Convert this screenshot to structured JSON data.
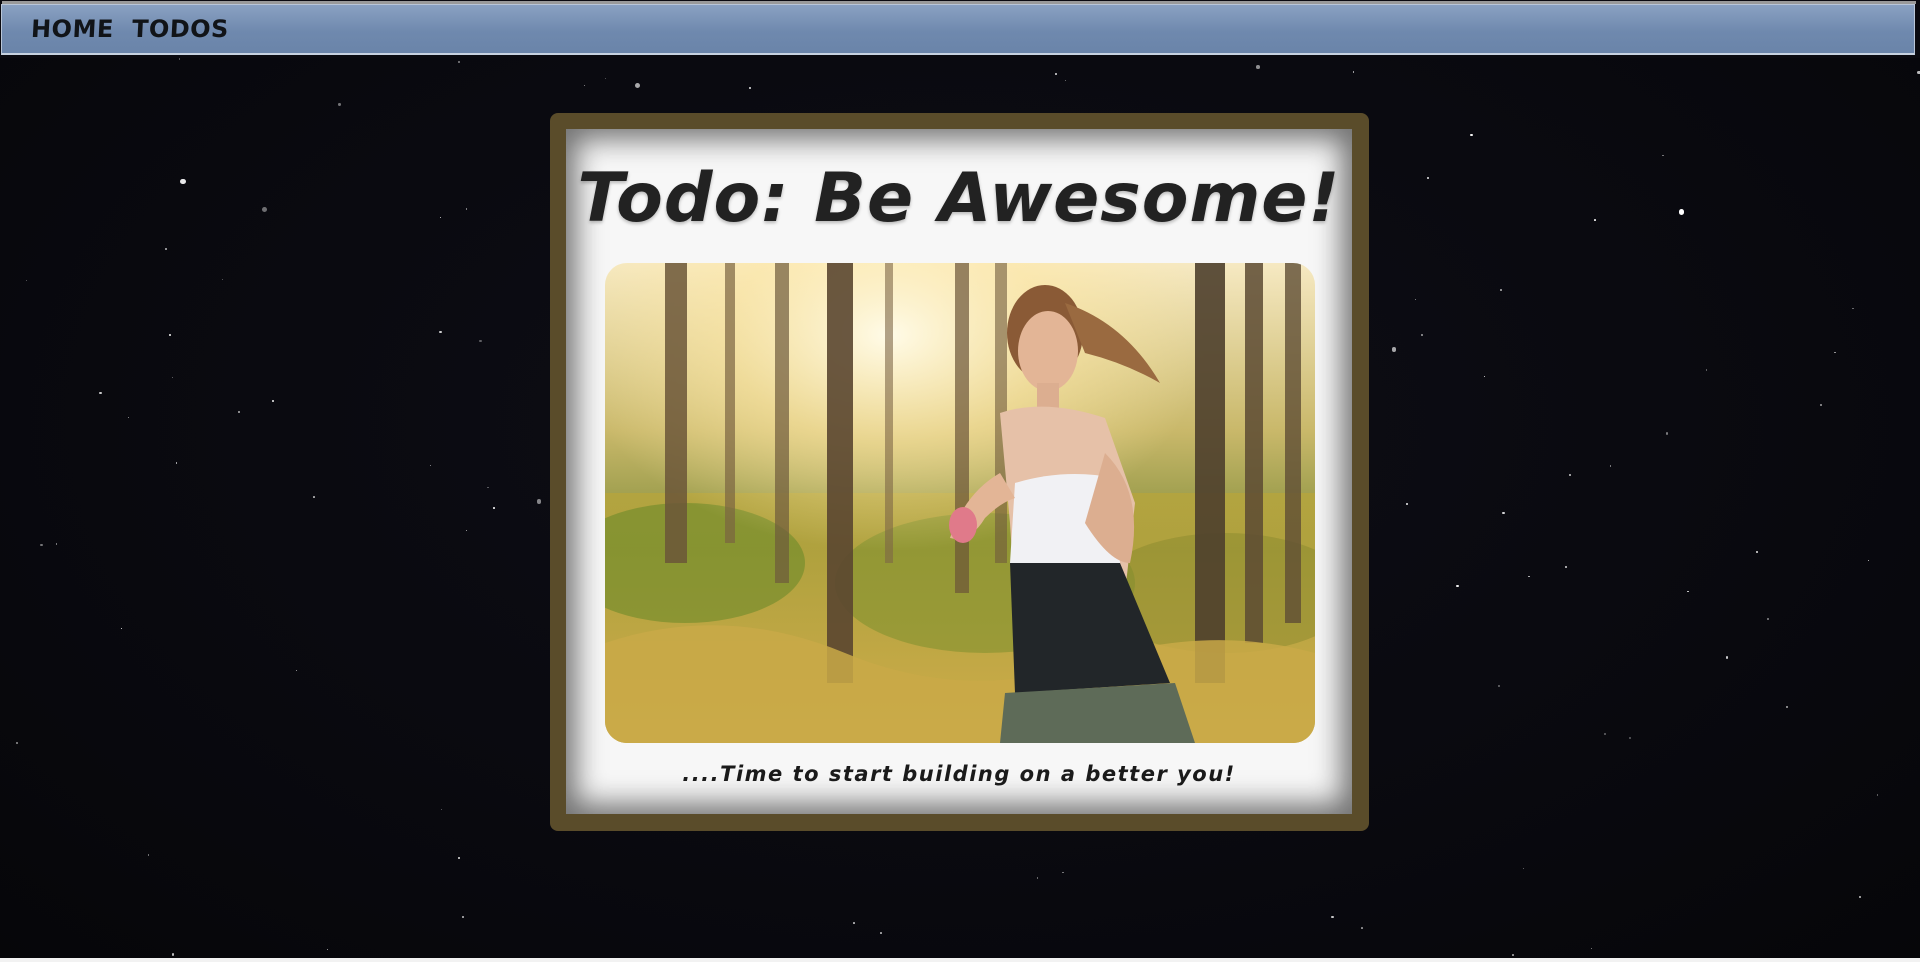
{
  "nav": {
    "items": [
      {
        "label": "HOME"
      },
      {
        "label": "TODOS"
      }
    ]
  },
  "hero": {
    "title": "Todo: Be Awesome!",
    "image": "woman-jogging-forest-photo",
    "caption": "....Time to start building on a better you!"
  },
  "colors": {
    "navbar": "#7089ae",
    "background": "#0a0a10",
    "frame": "#5a4c2a",
    "card": "#f7f7f7",
    "title": "#222222"
  }
}
